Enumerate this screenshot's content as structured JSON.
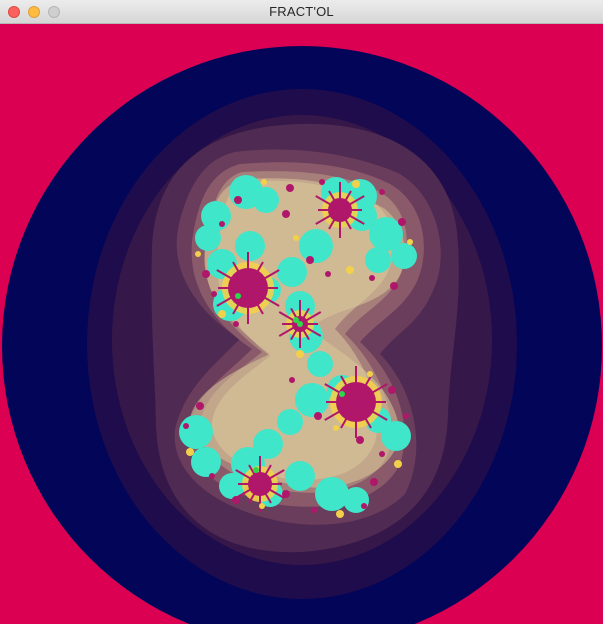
{
  "window": {
    "title": "FRACT'OL",
    "controls": {
      "close": "close-icon",
      "minimize": "minimize-icon",
      "zoom": "zoom-icon"
    }
  },
  "render": {
    "fractal": "julia-set",
    "colors": {
      "outside": "#db0052",
      "outer_band": "#020558",
      "band_1": "#1f0c4c",
      "band_2": "#351849",
      "band_3": "#4f2a52",
      "band_4": "#6b3d5c",
      "band_5": "#8a5a6a",
      "band_6": "#a67f7b",
      "band_7": "#c4a88e",
      "glow": "#d8c899",
      "cyan": "#3fe6c9",
      "yellow": "#f2d04a",
      "magenta": "#b0176b",
      "green": "#2bd94a"
    }
  }
}
